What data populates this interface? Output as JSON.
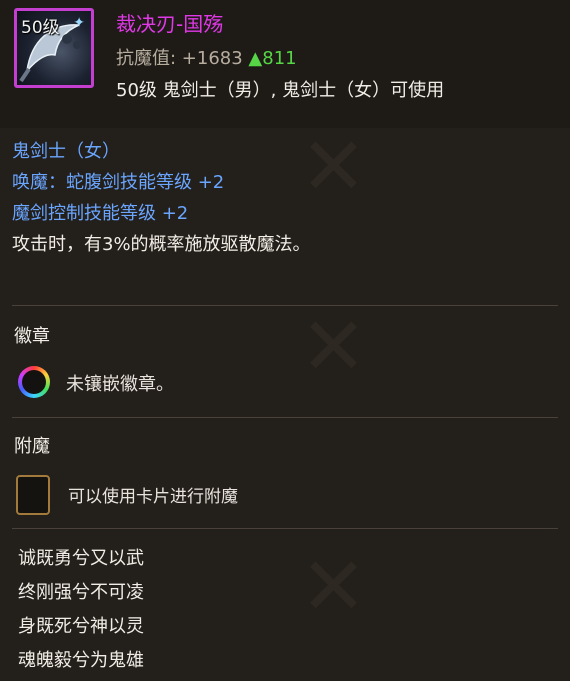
{
  "item": {
    "level_badge": "50级",
    "name": "裁决刃-国殇",
    "resist_label": "抗魔值: +1683",
    "resist_bonus": "▲811",
    "usable": "50级 鬼剑士（男）, 鬼剑士（女）可使用"
  },
  "attributes": [
    {
      "text": "鬼剑士（女）",
      "color": "#6aa5ff"
    },
    {
      "text": "唤魔：蛇腹剑技能等级 +2",
      "color": "#6aa5ff"
    },
    {
      "text": "魔剑控制技能等级 +2",
      "color": "#6aa5ff"
    },
    {
      "text": "攻击时，有3%的概率施放驱散魔法。",
      "color": "#f1ede6"
    }
  ],
  "emblem": {
    "title": "徽章",
    "status": "未镶嵌徽章。"
  },
  "enchant": {
    "title": "附魔",
    "hint": "可以使用卡片进行附魔"
  },
  "poem": [
    "诚既勇兮又以武",
    "终刚强兮不可凌",
    "身既死兮神以灵",
    "魂魄毅兮为鬼雄"
  ],
  "colors": {
    "name": "#e038e6",
    "frame": "#c43fd0",
    "bonus": "#56d646",
    "skill": "#6aa5ff"
  }
}
